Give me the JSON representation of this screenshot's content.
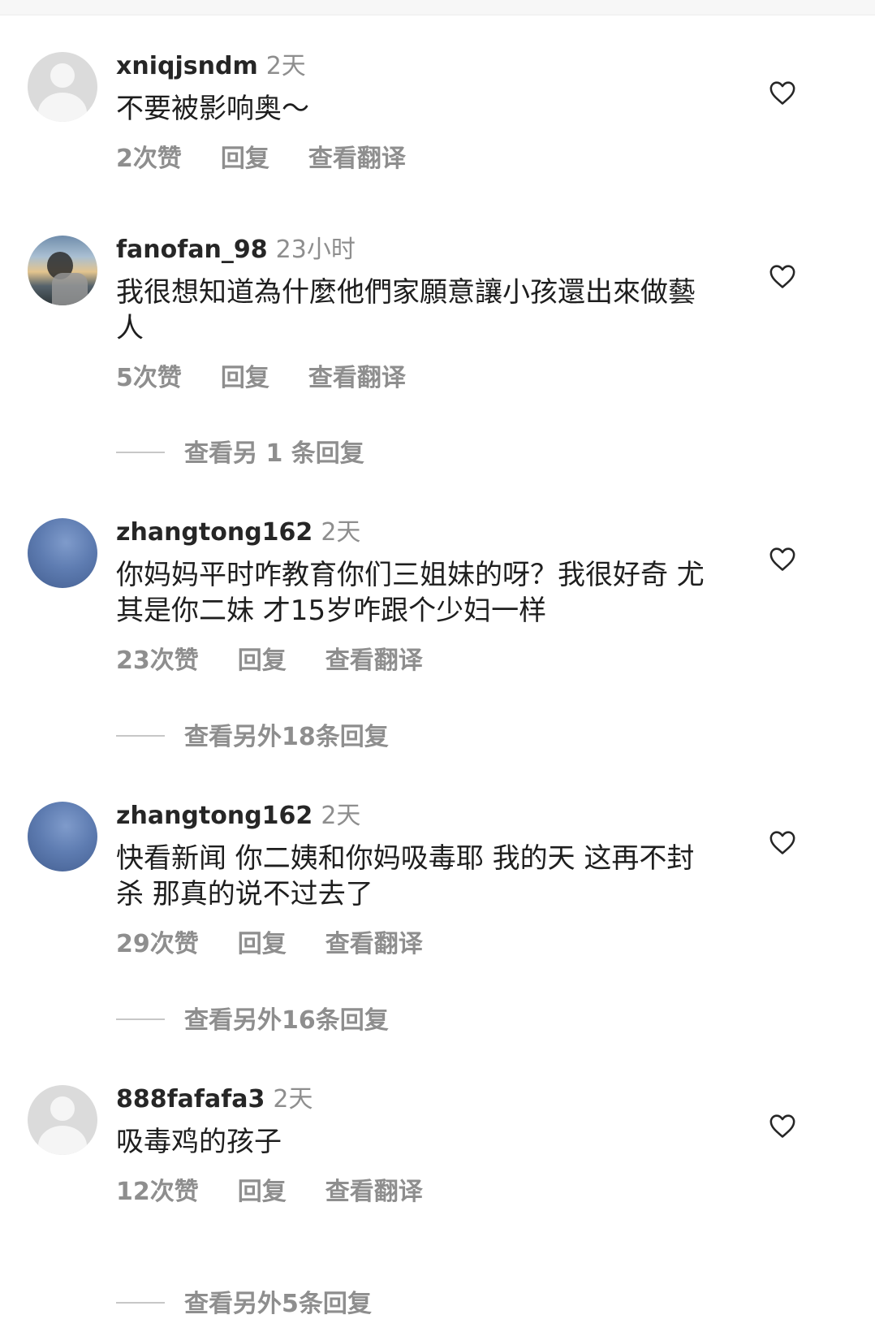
{
  "comments": [
    {
      "username": "xniqjsndm",
      "time": "2天",
      "text": "不要被影响奥～",
      "likes": "2次赞",
      "reply": "回复",
      "translate": "查看翻译",
      "avatar_icon": "default-avatar-icon"
    },
    {
      "username": "fanofan_98",
      "time": "23小时",
      "text": "我很想知道為什麼他們家願意讓小孩還出來做藝人",
      "likes": "5次赞",
      "reply": "回复",
      "translate": "查看翻译",
      "more_replies": "查看另 1 条回复",
      "avatar_icon": "photo-avatar-icon"
    },
    {
      "username": "zhangtong162",
      "time": "2天",
      "text": "你妈妈平时咋教育你们三姐妹的呀？我很好奇 尤其是你二妹 才15岁咋跟个少妇一样",
      "likes": "23次赞",
      "reply": "回复",
      "translate": "查看翻译",
      "more_replies": "查看另外18条回复",
      "avatar_icon": "blue-avatar-icon"
    },
    {
      "username": "zhangtong162",
      "time": "2天",
      "text": "快看新闻 你二姨和你妈吸毒耶 我的天 这再不封杀 那真的说不过去了",
      "likes": "29次赞",
      "reply": "回复",
      "translate": "查看翻译",
      "more_replies": "查看另外16条回复",
      "avatar_icon": "blue-avatar-icon"
    },
    {
      "username": "888fafafa3",
      "time": "2天",
      "text": "吸毒鸡的孩子",
      "likes": "12次赞",
      "reply": "回复",
      "translate": "查看翻译",
      "more_replies": "查看另外5条回复",
      "avatar_icon": "default-avatar-icon"
    }
  ],
  "colors": {
    "primary_text": "#262626",
    "secondary_text": "#8e8e8e",
    "avatar_placeholder": "#dbdbdb"
  },
  "icons": {
    "like": "heart-outline-icon"
  }
}
